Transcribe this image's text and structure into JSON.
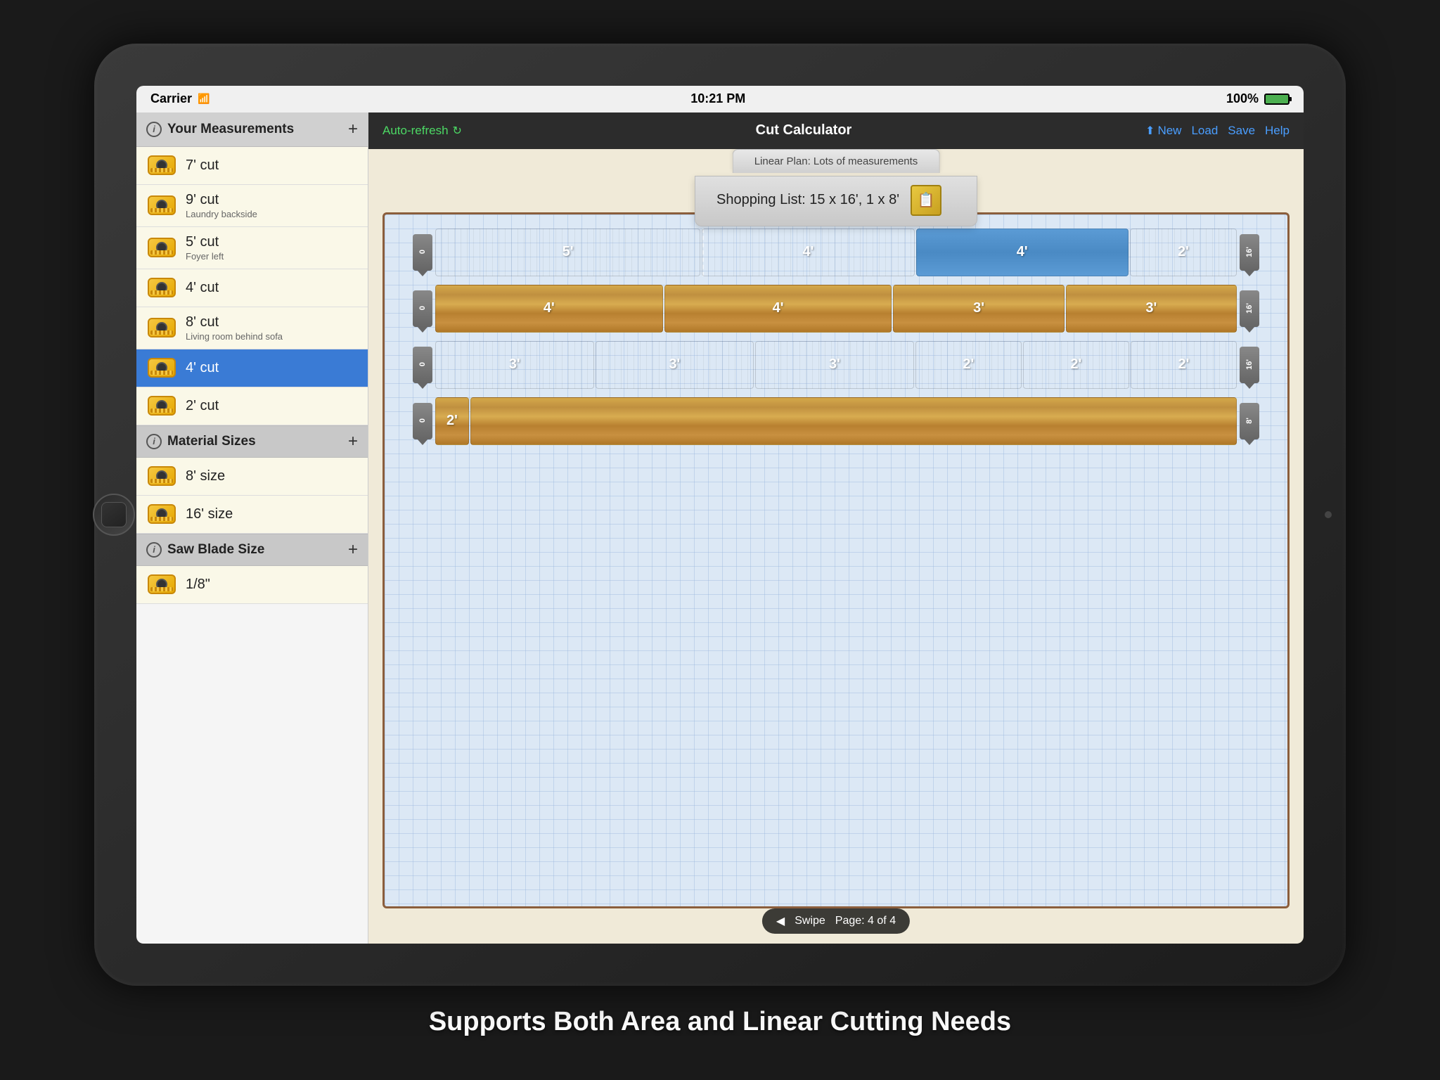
{
  "statusBar": {
    "carrier": "Carrier",
    "wifi": "WiFi",
    "time": "10:21 PM",
    "battery": "100%"
  },
  "leftPanel": {
    "measurements": {
      "title": "Your Measurements",
      "addBtn": "+",
      "items": [
        {
          "label": "7' cut",
          "sub": "",
          "selected": false
        },
        {
          "label": "9' cut",
          "sub": "Laundry backside",
          "selected": false
        },
        {
          "label": "5' cut",
          "sub": "Foyer left",
          "selected": false
        },
        {
          "label": "4' cut",
          "sub": "",
          "selected": false
        },
        {
          "label": "8' cut",
          "sub": "Living room behind sofa",
          "selected": false
        },
        {
          "label": "4' cut",
          "sub": "",
          "selected": true
        },
        {
          "label": "2' cut",
          "sub": "",
          "selected": false
        }
      ]
    },
    "materialSizes": {
      "title": "Material Sizes",
      "addBtn": "+",
      "items": [
        {
          "label": "8' size",
          "sub": ""
        },
        {
          "label": "16' size",
          "sub": ""
        }
      ]
    },
    "sawBlade": {
      "title": "Saw Blade Size",
      "addBtn": "+",
      "items": [
        {
          "label": "1/8\"",
          "sub": ""
        }
      ]
    }
  },
  "topBar": {
    "autoRefresh": "Auto-refresh",
    "title": "Cut Calculator",
    "newBtn": "New",
    "loadBtn": "Load",
    "saveBtn": "Save",
    "helpBtn": "Help"
  },
  "planArea": {
    "tabLabel": "Linear Plan: Lots of measurements",
    "shoppingList": "Shopping List: 15 x 16', 1 x 8'",
    "rows": [
      {
        "leftTag": "0",
        "rightTag": "16'",
        "segments": [
          {
            "label": "5'",
            "type": "brown",
            "flex": 5
          },
          {
            "label": "4'",
            "type": "brown",
            "flex": 4
          },
          {
            "label": "4'",
            "type": "blue",
            "flex": 4
          },
          {
            "label": "2'",
            "type": "brown",
            "flex": 2
          }
        ]
      },
      {
        "leftTag": "0",
        "rightTag": "16'",
        "segments": [
          {
            "label": "4'",
            "type": "brown-light",
            "flex": 4
          },
          {
            "label": "4'",
            "type": "brown-light",
            "flex": 4
          },
          {
            "label": "3'",
            "type": "brown-light",
            "flex": 3
          },
          {
            "label": "3'",
            "type": "brown-light",
            "flex": 3
          }
        ]
      },
      {
        "leftTag": "0",
        "rightTag": "16'",
        "segments": [
          {
            "label": "3'",
            "type": "brown",
            "flex": 3
          },
          {
            "label": "3'",
            "type": "brown",
            "flex": 3
          },
          {
            "label": "3'",
            "type": "brown",
            "flex": 3
          },
          {
            "label": "2'",
            "type": "brown",
            "flex": 2
          },
          {
            "label": "2'",
            "type": "brown",
            "flex": 2
          },
          {
            "label": "2'",
            "type": "brown",
            "flex": 2
          }
        ]
      },
      {
        "leftTag": "0",
        "rightTag": "8'",
        "segments": [
          {
            "label": "2'",
            "type": "brown-light",
            "flex": 2
          },
          {
            "label": "",
            "type": "brown-light",
            "flex": 5
          }
        ]
      }
    ],
    "swipe": {
      "arrow": "◀",
      "swipeLabel": "Swipe",
      "pageLabel": "Page: 4 of 4"
    }
  },
  "caption": "Supports Both Area and Linear Cutting Needs"
}
